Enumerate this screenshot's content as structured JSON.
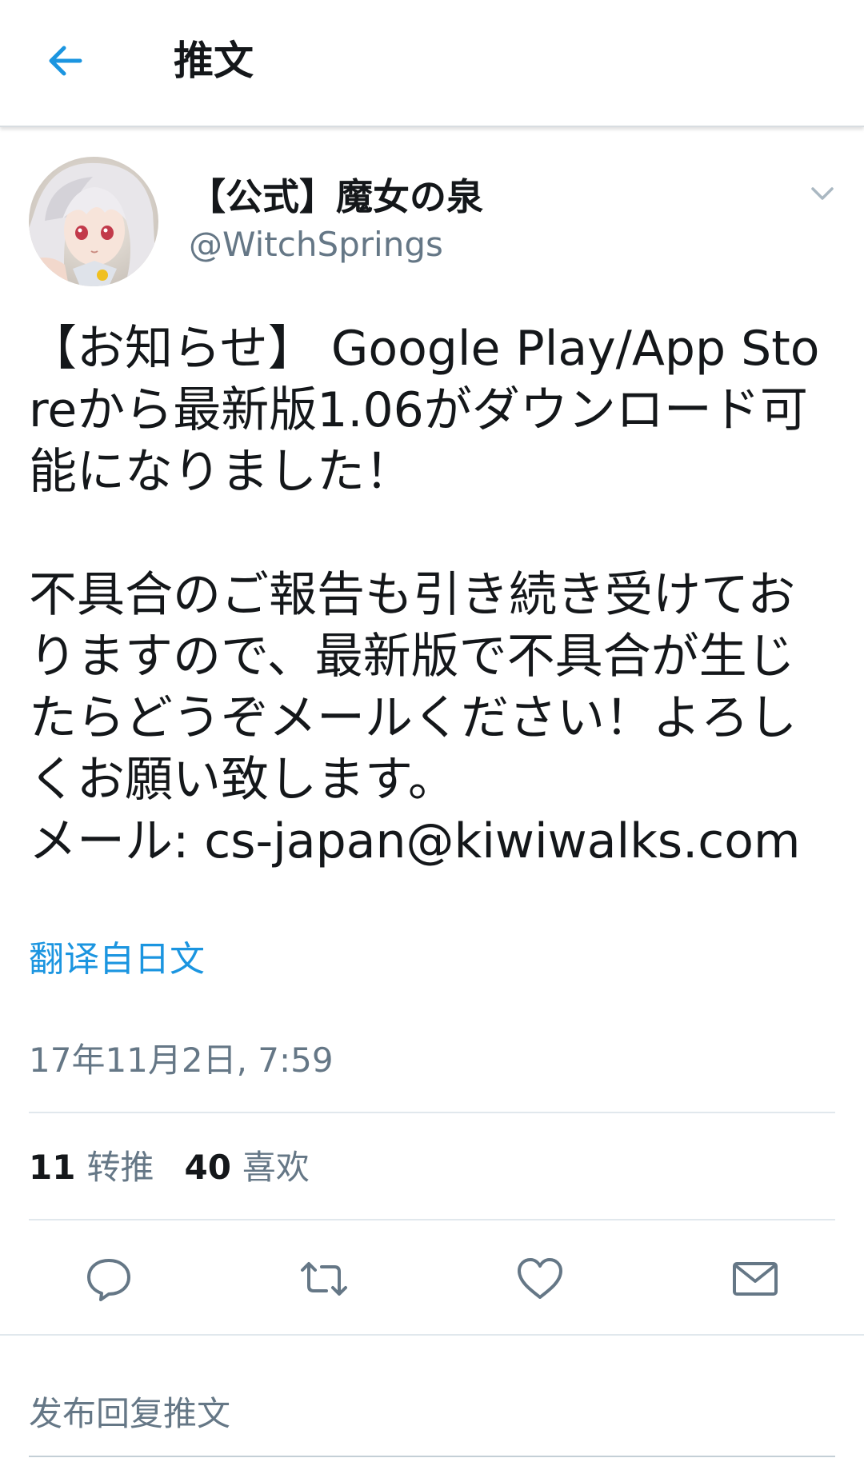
{
  "header": {
    "title": "推文"
  },
  "author": {
    "display_name": "【公式】魔女の泉",
    "handle": "@WitchSprings"
  },
  "tweet": {
    "text": "【お知らせ】 Google Play/App Storeから最新版1.06がダウンロード可能になりました！\n\n不具合のご報告も引き続き受けておりますので、最新版で不具合が生じたらどうぞメールください！よろしくお願い致します。\nメール: cs-japan@kiwiwalks.com",
    "translate_label": "翻译自日文",
    "timestamp": "17年11月2日, 7:59"
  },
  "stats": {
    "retweets": {
      "count": "11",
      "label": "转推"
    },
    "likes": {
      "count": "40",
      "label": "喜欢"
    }
  },
  "actions": [
    "reply-icon",
    "retweet-icon",
    "heart-icon",
    "mail-icon"
  ],
  "reply": {
    "placeholder": "发布回复推文"
  },
  "colors": {
    "accent": "#1b95e0",
    "text": "#14171a",
    "secondary": "#657786",
    "divider": "#e1e8ed"
  }
}
